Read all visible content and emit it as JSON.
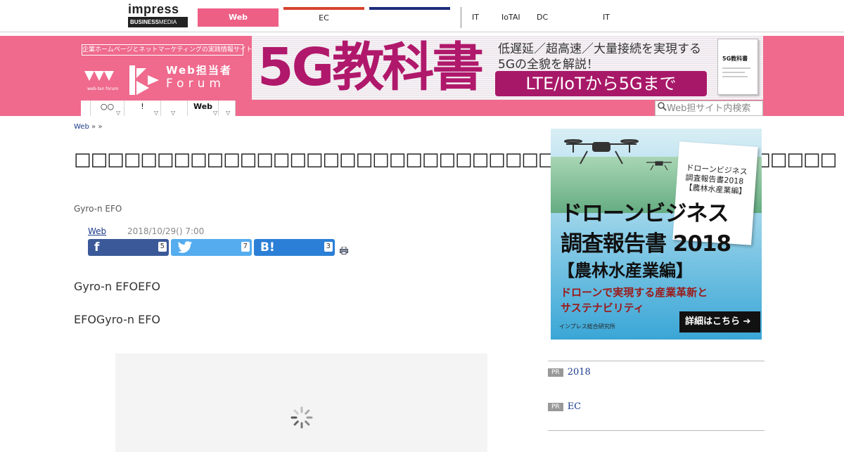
{
  "topbar": {
    "logo_top": "impress",
    "logo_bottom_a": "BUSINESS",
    "logo_bottom_b": "MEDIA",
    "tab_web": "Web",
    "tab_ec": "EC",
    "links": [
      "IT",
      "IoTAI",
      "DC",
      "IT"
    ],
    "colors": {
      "web": "#ee5f86",
      "ec": "#d7432f",
      "blank": "#1e2d7a"
    }
  },
  "header": {
    "tagline": "企業ホームページとネットマーケティングの実践情報サイト",
    "brand_line1": "Web担当者",
    "brand_line2": "Forum",
    "brand_small": "web-tan forum",
    "background": "#ef6a8d",
    "banner": {
      "headline": "5G教科書",
      "line1": "低遅延／超高速／大量接続を実現する",
      "line2": "5Gの全貌を解説！",
      "pill": "LTE/IoTから5Gまで",
      "book_title": "5G教科書"
    },
    "nav": [
      {
        "label": ""
      },
      {
        "label": "○○"
      },
      {
        "label": "!"
      },
      {
        "label": ""
      },
      {
        "label": "Web"
      },
      {
        "label": ""
      }
    ],
    "search_placeholder": "Web担サイト内検索"
  },
  "article": {
    "breadcrumb": [
      "Web",
      "»",
      "»"
    ],
    "title": "□□□□□□□□□□□□□□□□□□□□□□□□□□□□□□□□□□□□□□□□□□□□□□",
    "author": "Gyro-n EFO",
    "category": "Web",
    "date": "2018/10/29() 7:00",
    "shares": {
      "facebook": {
        "icon": "f",
        "count": "5"
      },
      "twitter": {
        "icon": "twitter-bird",
        "count": "7"
      },
      "hatena": {
        "icon": "B!",
        "count": "3"
      }
    },
    "paragraphs": [
      "Gyro-n EFOEFO",
      "EFOGyro-n EFO"
    ]
  },
  "sidebar": {
    "ad": {
      "line1": "ドローンビジネス",
      "line2": "調査報告書 2018",
      "line3": "【農林水産業編】",
      "sub1": "ドローンで実現する産業革新と",
      "sub2": "サステナビリティ",
      "cta": "詳細はこちら ➔",
      "maker": "インプレス総合研究所",
      "paper_title": "ドローンビジネス\n調査報告書2018\n【農林水産業編】"
    },
    "pr_items": [
      {
        "badge": "PR",
        "text": "2018"
      },
      {
        "badge": "PR",
        "text": "EC"
      }
    ]
  }
}
